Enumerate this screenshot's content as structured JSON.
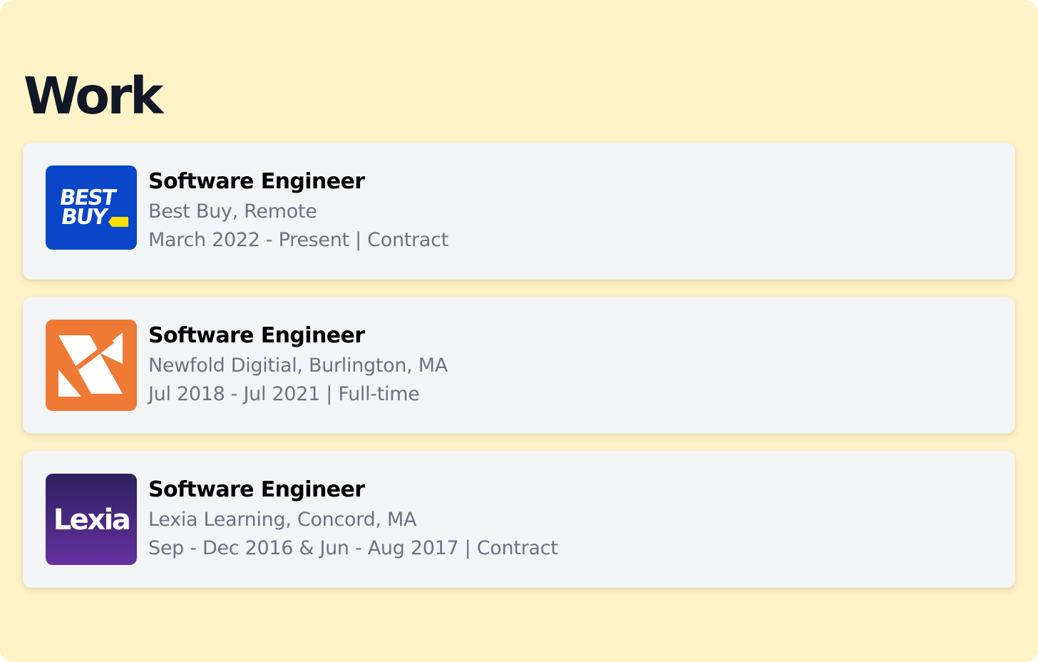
{
  "section": {
    "heading": "Work"
  },
  "jobs": [
    {
      "title": "Software Engineer",
      "company": "Best Buy, Remote",
      "period": "March 2022 - Present | Contract",
      "logo": {
        "icon": "best-buy-logo",
        "text_line1": "BEST",
        "text_line2": "BUY",
        "bg": "#0a46c8",
        "accent": "#ffe000"
      }
    },
    {
      "title": "Software Engineer",
      "company": "Newfold Digitial, Burlington, MA",
      "period": "Jul 2018 - Jul 2021 | Full-time",
      "logo": {
        "icon": "newfold-digital-logo",
        "bg": "#ef7a35"
      }
    },
    {
      "title": "Software Engineer",
      "company": "Lexia Learning, Concord, MA",
      "period": "Sep - Dec 2016 & Jun - Aug 2017 | Contract",
      "logo": {
        "icon": "lexia-logo",
        "text": "Lexia",
        "bg_top": "#2c2060",
        "bg_bottom": "#6630a0"
      }
    }
  ],
  "colors": {
    "page_bg": "#fef3c7",
    "card_bg": "#f3f4f6",
    "heading": "#111827",
    "subtext": "#6b7280"
  }
}
